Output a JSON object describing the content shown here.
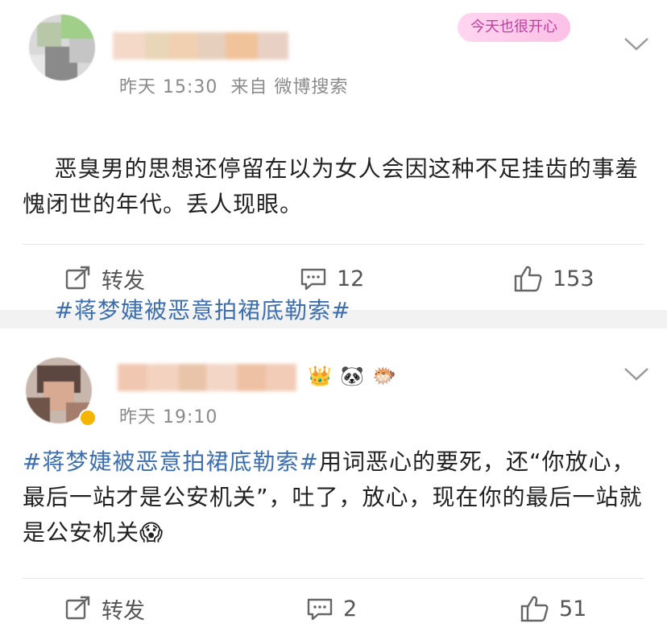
{
  "post1": {
    "time": "昨天 15:30",
    "source": "来自 微博搜索",
    "badge_text": "今天也很开心",
    "text": "恶臭男的思想还停留在以为女人会因这种不足挂齿的事羞愧闭世的年代。丢人现眼。",
    "hashtag": "#蒋梦婕被恶意拍裙底勒索#",
    "actions": {
      "repost": "转发",
      "comments": "12",
      "likes": "153"
    },
    "icons": {
      "repost": "share-icon",
      "comment": "comment-icon",
      "like": "thumbs-up-icon",
      "more": "chevron-down-icon"
    }
  },
  "post2": {
    "time": "昨天 19:10",
    "hashtag": "#蒋梦婕被恶意拍裙底勒索#",
    "text_after_hashtag": "用词恶心的要死，还“你放心，最后一站才是公安机关”，吐了，放心，现在你的最后一站就是公安机关",
    "trailing_emoji": "😱",
    "name_emojis": [
      "👑",
      "🐼",
      "🐡"
    ],
    "actions": {
      "repost": "转发",
      "comments": "2",
      "likes": "51"
    },
    "icons": {
      "repost": "share-icon",
      "comment": "comment-icon",
      "like": "thumbs-up-icon",
      "more": "chevron-down-icon"
    }
  },
  "colors": {
    "hashtag": "#3d6fb0",
    "background": "#f2f2f2",
    "card": "#ffffff",
    "meta_text": "#8a8a8a"
  }
}
